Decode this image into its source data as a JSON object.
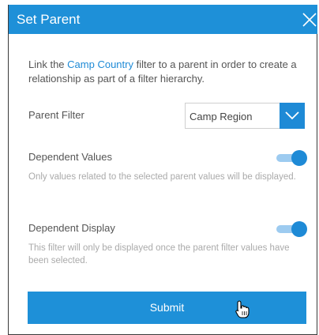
{
  "dialog": {
    "title": "Set Parent",
    "close_icon": "close-icon"
  },
  "description": {
    "before_link": "Link the ",
    "link": "Camp Country",
    "after_link": " filter to a parent in order to create a relationship as part of a filter hierarchy."
  },
  "parent_filter": {
    "label": "Parent Filter",
    "selected": "Camp Region",
    "arrow_icon": "chevron-down-icon"
  },
  "dependent_values": {
    "label": "Dependent Values",
    "enabled": true,
    "hint": "Only values related to the selected parent values will be displayed."
  },
  "dependent_display": {
    "label": "Dependent Display",
    "enabled": true,
    "hint": "This filter will only be displayed once the parent filter values have been selected."
  },
  "submit": {
    "label": "Submit"
  },
  "colors": {
    "accent": "#1e8ad6",
    "header": "#1e90d8",
    "toggle_track": "#9dcbf0",
    "text": "#555555",
    "hint": "#aaaaaa"
  },
  "cursor_icon": "hand-pointer-icon"
}
